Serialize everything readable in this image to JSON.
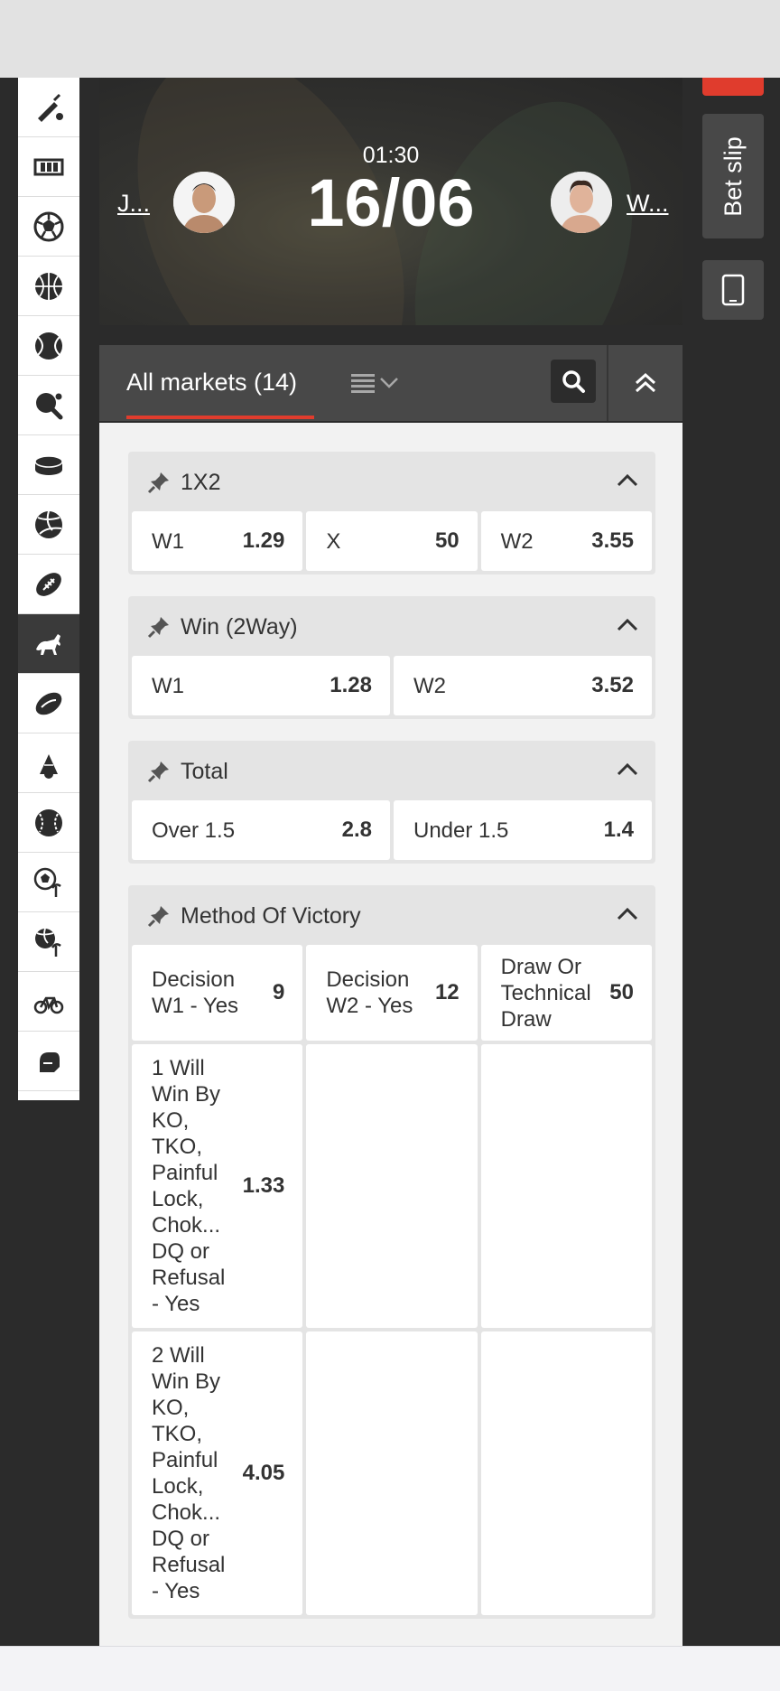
{
  "sports": [
    {
      "icon": "cricket-icon",
      "active": false
    },
    {
      "icon": "film-icon",
      "active": false
    },
    {
      "icon": "football-icon",
      "active": false
    },
    {
      "icon": "basketball-icon",
      "active": false
    },
    {
      "icon": "tennis-icon",
      "active": false
    },
    {
      "icon": "table-tennis-icon",
      "active": false
    },
    {
      "icon": "ice-hockey-icon",
      "active": false
    },
    {
      "icon": "volleyball-icon",
      "active": false
    },
    {
      "icon": "american-football-icon",
      "active": false
    },
    {
      "icon": "horse-racing-icon",
      "active": true
    },
    {
      "icon": "rugby-icon",
      "active": false
    },
    {
      "icon": "badminton-icon",
      "active": false
    },
    {
      "icon": "baseball-icon",
      "active": false
    },
    {
      "icon": "beach-soccer-icon",
      "active": false
    },
    {
      "icon": "beach-volleyball-icon",
      "active": false
    },
    {
      "icon": "cycling-icon",
      "active": false
    },
    {
      "icon": "boxing-icon",
      "active": false
    }
  ],
  "right_rail": {
    "bet_slip": "Bet slip"
  },
  "scoreboard": {
    "time": "01:30",
    "date": "16/06",
    "team1": "J...",
    "team2": "W..."
  },
  "markets_bar": {
    "all_markets": "All markets  (14)"
  },
  "markets": [
    {
      "title": "1X2",
      "columns": 3,
      "rows": [
        [
          {
            "label": "W1",
            "odd": "1.29"
          },
          {
            "label": "X",
            "odd": "50"
          },
          {
            "label": "W2",
            "odd": "3.55"
          }
        ]
      ]
    },
    {
      "title": "Win (2Way)",
      "columns": 2,
      "rows": [
        [
          {
            "label": "W1",
            "odd": "1.28"
          },
          {
            "label": "W2",
            "odd": "3.52"
          }
        ]
      ]
    },
    {
      "title": "Total",
      "columns": 2,
      "rows": [
        [
          {
            "label": "Over 1.5",
            "odd": "2.8"
          },
          {
            "label": "Under 1.5",
            "odd": "1.4"
          }
        ]
      ]
    },
    {
      "title": "Method Of Victory",
      "columns": 3,
      "rows": [
        [
          {
            "label": "Decision W1 - Yes",
            "odd": "9"
          },
          {
            "label": "Decision W2 - Yes",
            "odd": "12"
          },
          {
            "label": "Draw Or Technical Draw",
            "odd": "50"
          }
        ],
        [
          {
            "label": "1 Will Win By KO, TKO, Painful Lock, Chok... DQ or Refusal - Yes",
            "odd": "1.33"
          },
          null,
          null
        ],
        [
          {
            "label": "2 Will Win By KO, TKO, Painful Lock, Chok... DQ or Refusal - Yes",
            "odd": "4.05"
          },
          null,
          null
        ]
      ]
    }
  ]
}
